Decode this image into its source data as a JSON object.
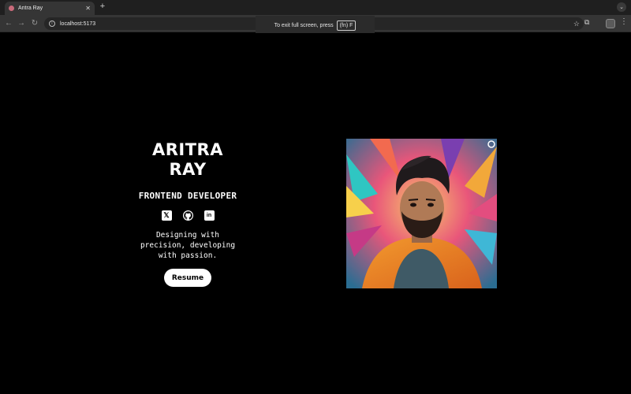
{
  "browser": {
    "tab_title": "Aritra Ray",
    "url": "localhost:5173",
    "fullscreen_toast": {
      "message": "To exit full screen, press",
      "key": "(fn) F"
    }
  },
  "profile": {
    "name_line1": "ARITRA",
    "name_line2": "RAY",
    "role": "FRONTEND DEVELOPER",
    "tagline_line1": "Designing with",
    "tagline_line2": "precision, developing",
    "tagline_line3": "with passion.",
    "resume_label": "Resume"
  },
  "icons": {
    "socials": [
      "x-twitter-icon",
      "github-icon",
      "linkedin-icon"
    ]
  },
  "colors": {
    "background": "#000000",
    "text": "#ffffff",
    "button_bg": "#ffffff"
  }
}
